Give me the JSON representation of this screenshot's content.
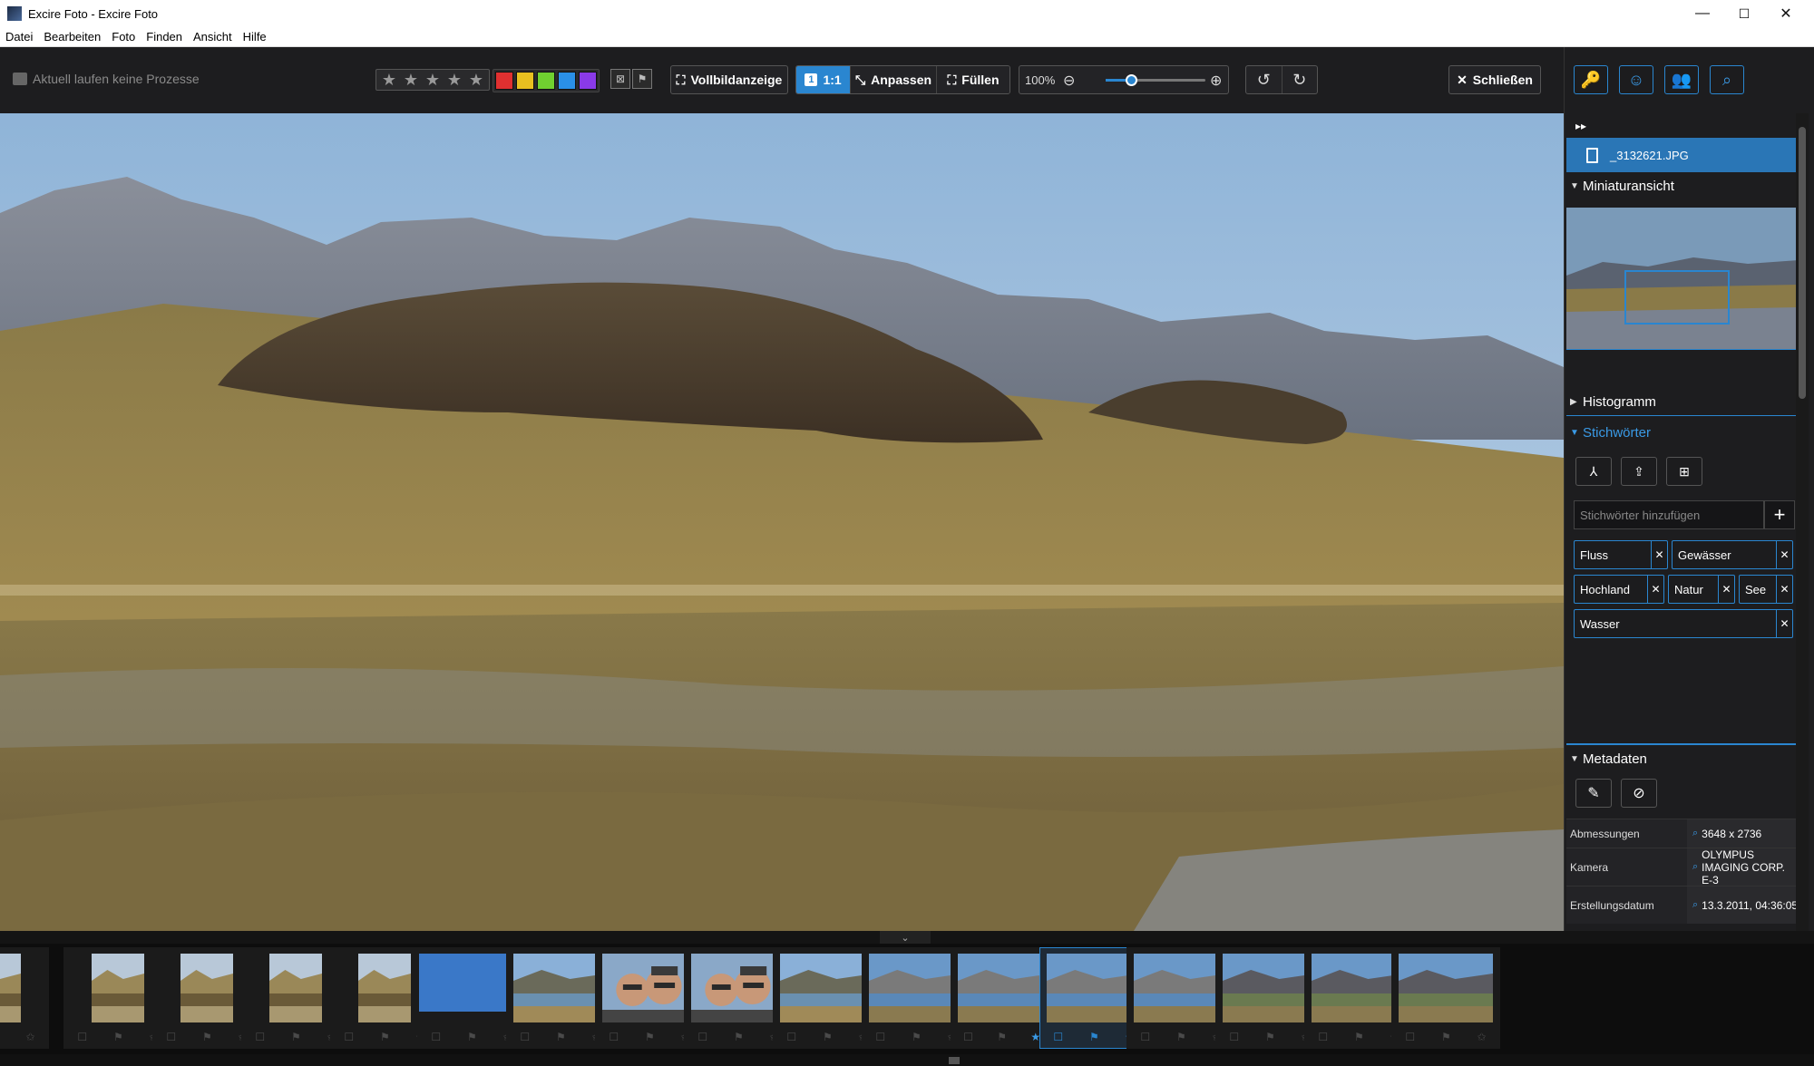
{
  "window": {
    "title": "Excire Foto - Excire Foto",
    "minimize": "—",
    "maximize": "☐",
    "close": "✕"
  },
  "menu": [
    "Datei",
    "Bearbeiten",
    "Foto",
    "Finden",
    "Ansicht",
    "Hilfe"
  ],
  "toolbar": {
    "status_text": "Aktuell laufen keine Prozesse",
    "color_labels": [
      "#e03030",
      "#e8c020",
      "#70d030",
      "#2a90e8",
      "#8a3ae8"
    ],
    "fullscreen_label": "Vollbildanzeige",
    "one_to_one_badge": "1",
    "one_to_one_label": "1:1",
    "fit_label": "Anpassen",
    "fill_label": "Füllen",
    "zoom_value": "100%",
    "zoom_level": 0.25,
    "close_label": "Schließen"
  },
  "right_panel": {
    "file_name": "_3132621.JPG",
    "sections": {
      "thumbnail": "Miniaturansicht",
      "histogram": "Histogramm",
      "keywords": "Stichwörter",
      "metadata": "Metadaten"
    },
    "keyword_placeholder": "Stichwörter hinzufügen",
    "tags": [
      "Fluss",
      "Gewässer",
      "Hochland",
      "Natur",
      "See",
      "Wasser"
    ],
    "meta": [
      {
        "key": "Abmessungen",
        "value": "3648 x 2736"
      },
      {
        "key": "Kamera",
        "value": "OLYMPUS IMAGING CORP. E-3"
      },
      {
        "key": "Erstellungsdatum",
        "value": "13.3.2011, 04:36:05"
      }
    ]
  },
  "filmstrip": {
    "selected_index": 12,
    "rating_badge": "5",
    "items": [
      "dry-shrub",
      "dry-shrub",
      "dry-shrub",
      "dry-shrub",
      "dry-shrub",
      "blue-sky",
      "lake-landscape",
      "selfie",
      "selfie",
      "lake-landscape",
      "river-mountains",
      "river-mountains",
      "river-mountains",
      "river-mountains",
      "mountain-valley",
      "mountain-valley",
      "mountain-valley"
    ]
  }
}
